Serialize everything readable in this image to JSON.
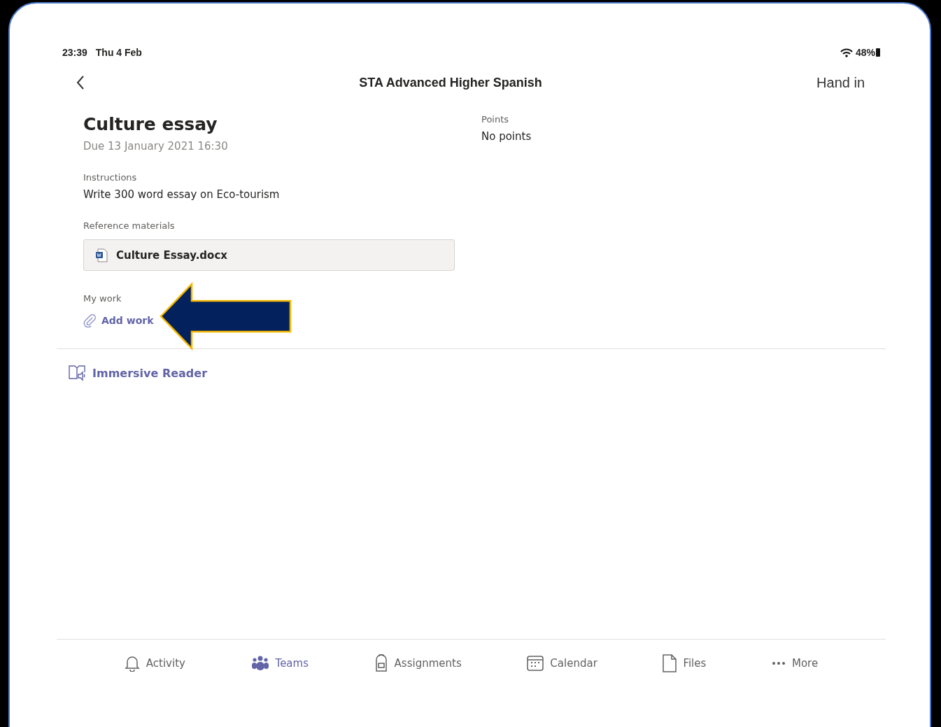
{
  "status_bar": {
    "time": "23:39",
    "date": "Thu 4 Feb",
    "battery": "48%"
  },
  "header": {
    "title": "STA Advanced Higher Spanish",
    "action": "Hand in"
  },
  "assignment": {
    "title": "Culture essay",
    "due": "Due 13 January 2021 16:30",
    "instructions_label": "Instructions",
    "instructions": "Write 300 word essay on Eco-tourism",
    "reference_label": "Reference materials",
    "reference_file": "Culture Essay.docx",
    "my_work_label": "My work",
    "add_work": "Add work",
    "points_label": "Points",
    "points": "No points"
  },
  "immersive_reader": "Immersive Reader",
  "tabs": [
    {
      "kind": "bell",
      "label": "Activity",
      "selected": false
    },
    {
      "kind": "teams",
      "label": "Teams",
      "selected": true
    },
    {
      "kind": "backpack",
      "label": "Assignments",
      "selected": false
    },
    {
      "kind": "calendar",
      "label": "Calendar",
      "selected": false
    },
    {
      "kind": "file",
      "label": "Files",
      "selected": false
    },
    {
      "kind": "more",
      "label": "More",
      "selected": false
    }
  ]
}
